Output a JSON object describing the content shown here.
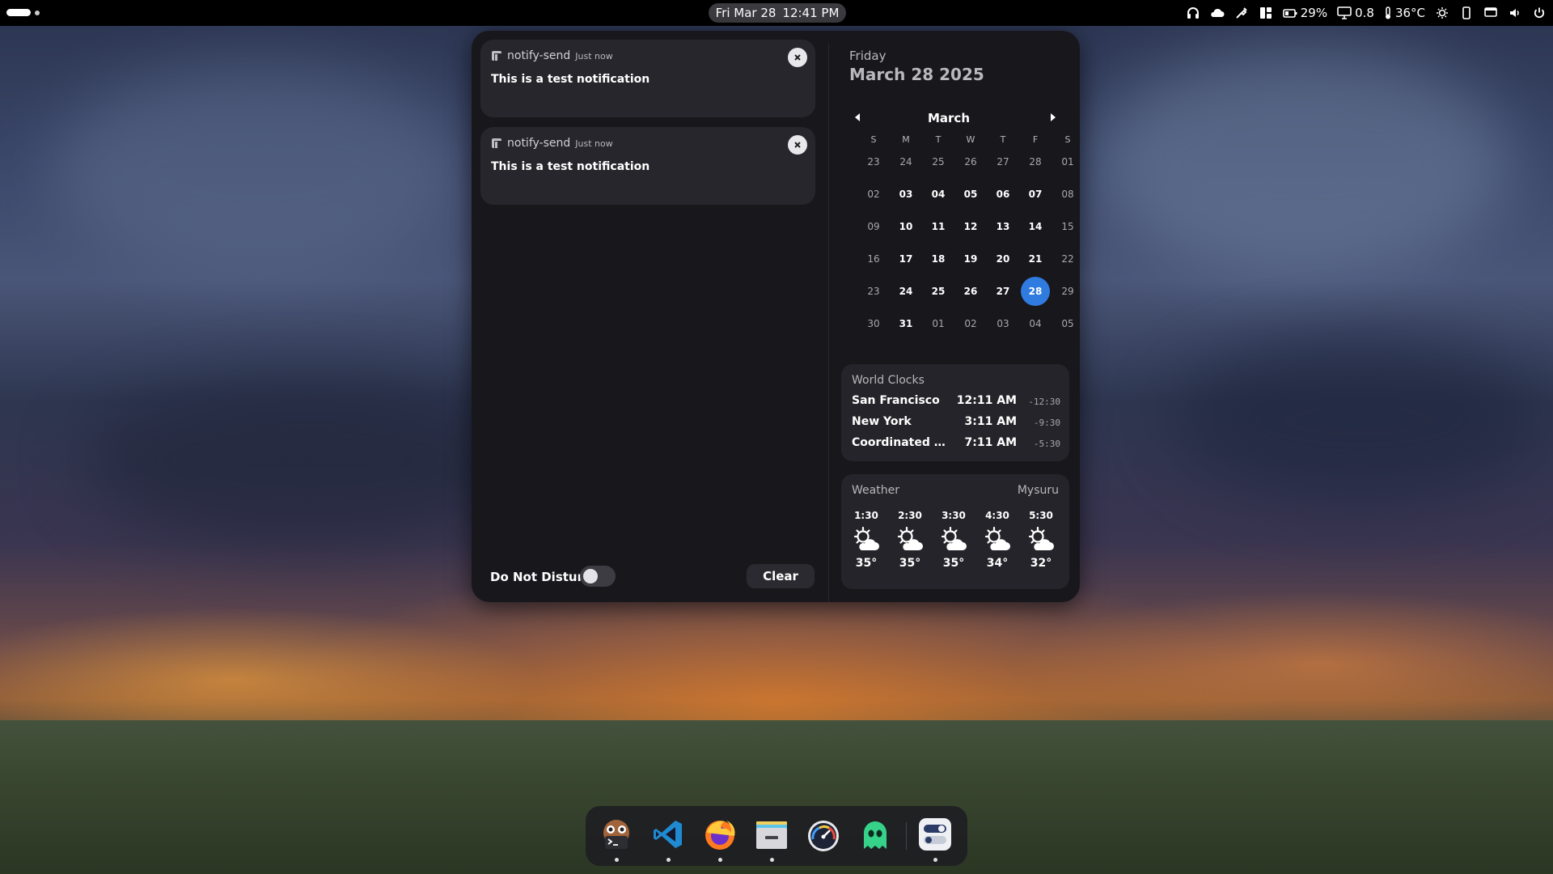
{
  "topbar": {
    "clock_date": "Fri Mar 28",
    "clock_time": "12:41 PM",
    "battery": "29%",
    "load": "0.8",
    "temperature": "36°C"
  },
  "notifications": [
    {
      "app": "notify-send",
      "time": "Just now",
      "body": "This is a test notification"
    },
    {
      "app": "notify-send",
      "time": "Just now",
      "body": "This is a test notification"
    }
  ],
  "controls": {
    "dnd_label": "Do Not Disturb",
    "dnd_enabled": false,
    "clear_label": "Clear"
  },
  "calendar": {
    "weekday": "Friday",
    "full_date": "March 28 2025",
    "month": "March",
    "weekdays": [
      "S",
      "M",
      "T",
      "W",
      "T",
      "F",
      "S"
    ],
    "weeks": [
      [
        "23",
        "24",
        "25",
        "26",
        "27",
        "28",
        "01"
      ],
      [
        "02",
        "03",
        "04",
        "05",
        "06",
        "07",
        "08"
      ],
      [
        "09",
        "10",
        "11",
        "12",
        "13",
        "14",
        "15"
      ],
      [
        "16",
        "17",
        "18",
        "19",
        "20",
        "21",
        "22"
      ],
      [
        "23",
        "24",
        "25",
        "26",
        "27",
        "28",
        "29"
      ],
      [
        "30",
        "31",
        "01",
        "02",
        "03",
        "04",
        "05"
      ]
    ],
    "today": "28"
  },
  "world_clocks": {
    "title": "World Clocks",
    "rows": [
      {
        "city": "San Francisco",
        "time": "12:11 AM",
        "offset": "-12:30"
      },
      {
        "city": "New York",
        "time": "3:11 AM",
        "offset": "-9:30"
      },
      {
        "city": "Coordinated U...",
        "time": "7:11 AM",
        "offset": "-5:30"
      }
    ]
  },
  "weather": {
    "title": "Weather",
    "location": "Mysuru",
    "hours": [
      {
        "time": "1:30",
        "temp": "35°",
        "icon": "partly-cloudy-icon"
      },
      {
        "time": "2:30",
        "temp": "35°",
        "icon": "partly-cloudy-icon"
      },
      {
        "time": "3:30",
        "temp": "35°",
        "icon": "partly-cloudy-icon"
      },
      {
        "time": "4:30",
        "temp": "34°",
        "icon": "partly-cloudy-icon"
      },
      {
        "time": "5:30",
        "temp": "32°",
        "icon": "partly-cloudy-icon"
      }
    ]
  },
  "dock": [
    {
      "name": "terminal",
      "running": true
    },
    {
      "name": "vscode",
      "running": true
    },
    {
      "name": "firefox",
      "running": true
    },
    {
      "name": "file-manager",
      "running": true
    },
    {
      "name": "system-monitor",
      "running": false
    },
    {
      "name": "ghost-app",
      "running": false
    },
    {
      "name": "settings-app",
      "running": true
    }
  ]
}
